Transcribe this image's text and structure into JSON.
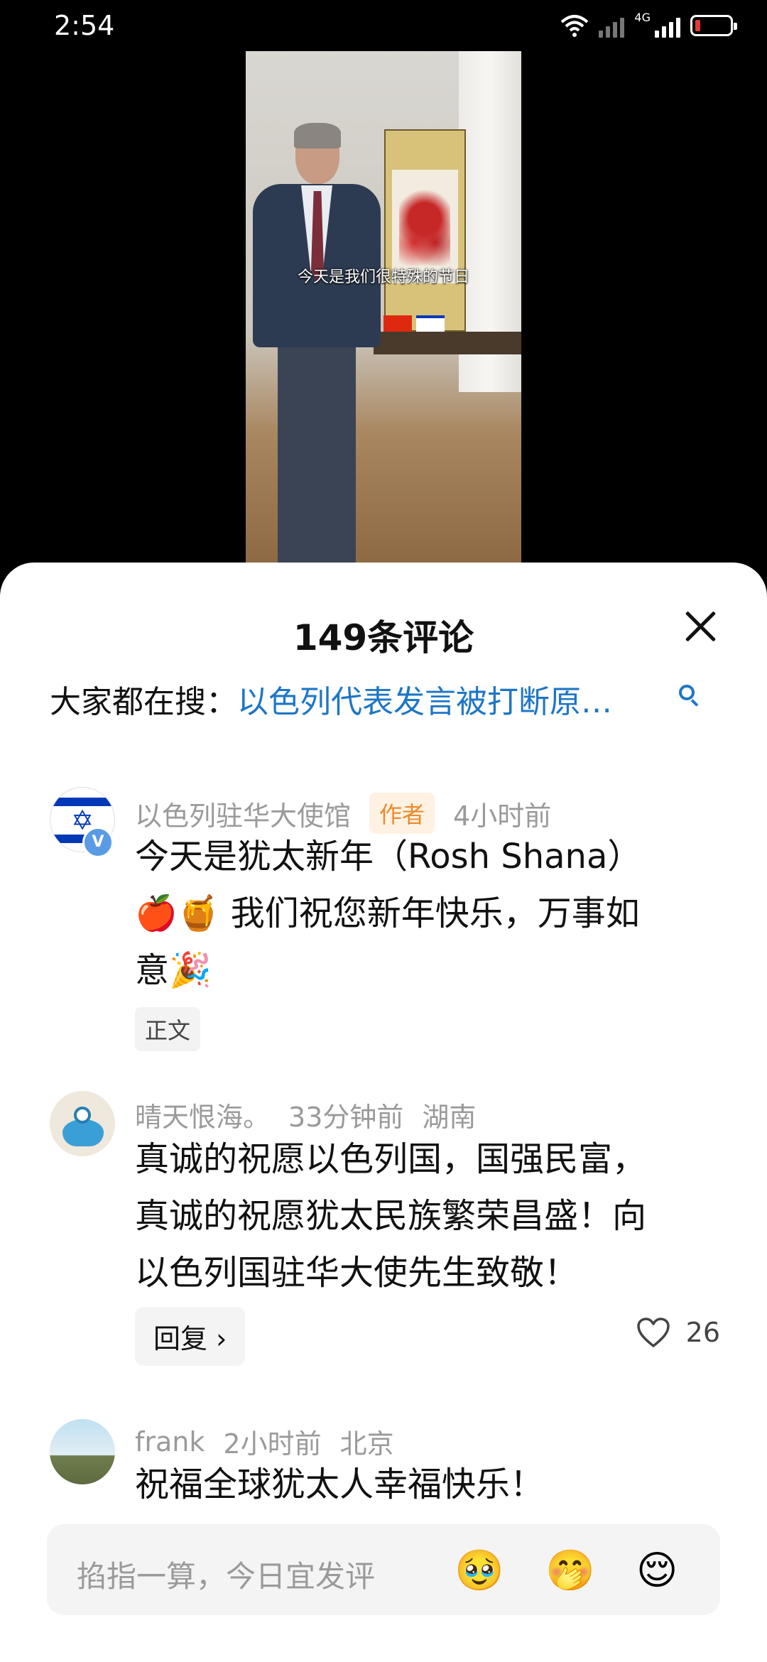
{
  "status_bar": {
    "time": "2:54",
    "network": "4G"
  },
  "video": {
    "caption": "今天是我们很特殊的节日"
  },
  "comments_panel": {
    "title": "149条评论",
    "hot_search_label": "大家都在搜：",
    "hot_search_query": "以色列代表发言被打断原…"
  },
  "comments": [
    {
      "username": "以色列驻华大使馆",
      "author_badge": "作者",
      "time": "4小时前",
      "text_line1": "今天是犹太新年（Rosh Shana）",
      "text_line2": "🍎🍯 我们祝您新年快乐，万事如",
      "text_line3": "意🎉",
      "tag": "正文"
    },
    {
      "username": "晴天恨海。",
      "time": "33分钟前",
      "location": "湖南",
      "text_line1": "真诚的祝愿以色列国，国强民富，",
      "text_line2": "真诚的祝愿犹太民族繁荣昌盛！向",
      "text_line3": "以色列国驻华大使先生致敬！",
      "reply_label": "回复 ›",
      "like_count": "26"
    },
    {
      "username": "frank",
      "time": "2小时前",
      "location": "北京",
      "text_line1": "祝福全球犹太人幸福快乐！"
    }
  ],
  "input": {
    "placeholder": "掐指一算，今日宜发评",
    "emojis": [
      "🥹",
      "🤭",
      "😌"
    ]
  }
}
